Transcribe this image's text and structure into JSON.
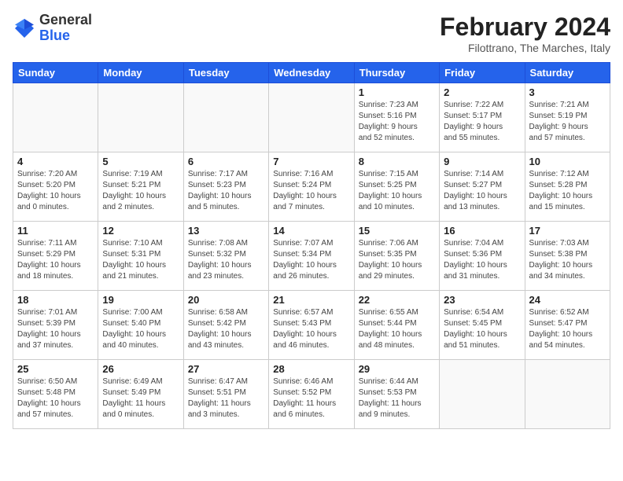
{
  "header": {
    "logo_general": "General",
    "logo_blue": "Blue",
    "month_year": "February 2024",
    "location": "Filottrano, The Marches, Italy"
  },
  "days_of_week": [
    "Sunday",
    "Monday",
    "Tuesday",
    "Wednesday",
    "Thursday",
    "Friday",
    "Saturday"
  ],
  "weeks": [
    [
      {
        "day": "",
        "detail": ""
      },
      {
        "day": "",
        "detail": ""
      },
      {
        "day": "",
        "detail": ""
      },
      {
        "day": "",
        "detail": ""
      },
      {
        "day": "1",
        "detail": "Sunrise: 7:23 AM\nSunset: 5:16 PM\nDaylight: 9 hours\nand 52 minutes."
      },
      {
        "day": "2",
        "detail": "Sunrise: 7:22 AM\nSunset: 5:17 PM\nDaylight: 9 hours\nand 55 minutes."
      },
      {
        "day": "3",
        "detail": "Sunrise: 7:21 AM\nSunset: 5:19 PM\nDaylight: 9 hours\nand 57 minutes."
      }
    ],
    [
      {
        "day": "4",
        "detail": "Sunrise: 7:20 AM\nSunset: 5:20 PM\nDaylight: 10 hours\nand 0 minutes."
      },
      {
        "day": "5",
        "detail": "Sunrise: 7:19 AM\nSunset: 5:21 PM\nDaylight: 10 hours\nand 2 minutes."
      },
      {
        "day": "6",
        "detail": "Sunrise: 7:17 AM\nSunset: 5:23 PM\nDaylight: 10 hours\nand 5 minutes."
      },
      {
        "day": "7",
        "detail": "Sunrise: 7:16 AM\nSunset: 5:24 PM\nDaylight: 10 hours\nand 7 minutes."
      },
      {
        "day": "8",
        "detail": "Sunrise: 7:15 AM\nSunset: 5:25 PM\nDaylight: 10 hours\nand 10 minutes."
      },
      {
        "day": "9",
        "detail": "Sunrise: 7:14 AM\nSunset: 5:27 PM\nDaylight: 10 hours\nand 13 minutes."
      },
      {
        "day": "10",
        "detail": "Sunrise: 7:12 AM\nSunset: 5:28 PM\nDaylight: 10 hours\nand 15 minutes."
      }
    ],
    [
      {
        "day": "11",
        "detail": "Sunrise: 7:11 AM\nSunset: 5:29 PM\nDaylight: 10 hours\nand 18 minutes."
      },
      {
        "day": "12",
        "detail": "Sunrise: 7:10 AM\nSunset: 5:31 PM\nDaylight: 10 hours\nand 21 minutes."
      },
      {
        "day": "13",
        "detail": "Sunrise: 7:08 AM\nSunset: 5:32 PM\nDaylight: 10 hours\nand 23 minutes."
      },
      {
        "day": "14",
        "detail": "Sunrise: 7:07 AM\nSunset: 5:34 PM\nDaylight: 10 hours\nand 26 minutes."
      },
      {
        "day": "15",
        "detail": "Sunrise: 7:06 AM\nSunset: 5:35 PM\nDaylight: 10 hours\nand 29 minutes."
      },
      {
        "day": "16",
        "detail": "Sunrise: 7:04 AM\nSunset: 5:36 PM\nDaylight: 10 hours\nand 31 minutes."
      },
      {
        "day": "17",
        "detail": "Sunrise: 7:03 AM\nSunset: 5:38 PM\nDaylight: 10 hours\nand 34 minutes."
      }
    ],
    [
      {
        "day": "18",
        "detail": "Sunrise: 7:01 AM\nSunset: 5:39 PM\nDaylight: 10 hours\nand 37 minutes."
      },
      {
        "day": "19",
        "detail": "Sunrise: 7:00 AM\nSunset: 5:40 PM\nDaylight: 10 hours\nand 40 minutes."
      },
      {
        "day": "20",
        "detail": "Sunrise: 6:58 AM\nSunset: 5:42 PM\nDaylight: 10 hours\nand 43 minutes."
      },
      {
        "day": "21",
        "detail": "Sunrise: 6:57 AM\nSunset: 5:43 PM\nDaylight: 10 hours\nand 46 minutes."
      },
      {
        "day": "22",
        "detail": "Sunrise: 6:55 AM\nSunset: 5:44 PM\nDaylight: 10 hours\nand 48 minutes."
      },
      {
        "day": "23",
        "detail": "Sunrise: 6:54 AM\nSunset: 5:45 PM\nDaylight: 10 hours\nand 51 minutes."
      },
      {
        "day": "24",
        "detail": "Sunrise: 6:52 AM\nSunset: 5:47 PM\nDaylight: 10 hours\nand 54 minutes."
      }
    ],
    [
      {
        "day": "25",
        "detail": "Sunrise: 6:50 AM\nSunset: 5:48 PM\nDaylight: 10 hours\nand 57 minutes."
      },
      {
        "day": "26",
        "detail": "Sunrise: 6:49 AM\nSunset: 5:49 PM\nDaylight: 11 hours\nand 0 minutes."
      },
      {
        "day": "27",
        "detail": "Sunrise: 6:47 AM\nSunset: 5:51 PM\nDaylight: 11 hours\nand 3 minutes."
      },
      {
        "day": "28",
        "detail": "Sunrise: 6:46 AM\nSunset: 5:52 PM\nDaylight: 11 hours\nand 6 minutes."
      },
      {
        "day": "29",
        "detail": "Sunrise: 6:44 AM\nSunset: 5:53 PM\nDaylight: 11 hours\nand 9 minutes."
      },
      {
        "day": "",
        "detail": ""
      },
      {
        "day": "",
        "detail": ""
      }
    ]
  ]
}
